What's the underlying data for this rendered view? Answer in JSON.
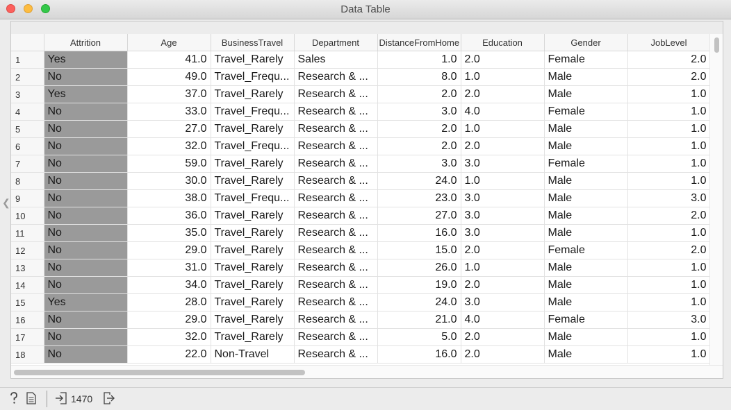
{
  "window": {
    "title": "Data Table"
  },
  "table": {
    "columns": [
      "Attrition",
      "Age",
      "BusinessTravel",
      "Department",
      "DistanceFromHome",
      "Education",
      "Gender",
      "JobLevel"
    ],
    "rows": [
      [
        "1",
        "Yes",
        "41.0",
        "Travel_Rarely",
        "Sales",
        "1.0",
        "2.0",
        "Female",
        "2.0"
      ],
      [
        "2",
        "No",
        "49.0",
        "Travel_Frequ...",
        "Research & ...",
        "8.0",
        "1.0",
        "Male",
        "2.0"
      ],
      [
        "3",
        "Yes",
        "37.0",
        "Travel_Rarely",
        "Research & ...",
        "2.0",
        "2.0",
        "Male",
        "1.0"
      ],
      [
        "4",
        "No",
        "33.0",
        "Travel_Frequ...",
        "Research & ...",
        "3.0",
        "4.0",
        "Female",
        "1.0"
      ],
      [
        "5",
        "No",
        "27.0",
        "Travel_Rarely",
        "Research & ...",
        "2.0",
        "1.0",
        "Male",
        "1.0"
      ],
      [
        "6",
        "No",
        "32.0",
        "Travel_Frequ...",
        "Research & ...",
        "2.0",
        "2.0",
        "Male",
        "1.0"
      ],
      [
        "7",
        "No",
        "59.0",
        "Travel_Rarely",
        "Research & ...",
        "3.0",
        "3.0",
        "Female",
        "1.0"
      ],
      [
        "8",
        "No",
        "30.0",
        "Travel_Rarely",
        "Research & ...",
        "24.0",
        "1.0",
        "Male",
        "1.0"
      ],
      [
        "9",
        "No",
        "38.0",
        "Travel_Frequ...",
        "Research & ...",
        "23.0",
        "3.0",
        "Male",
        "3.0"
      ],
      [
        "10",
        "No",
        "36.0",
        "Travel_Rarely",
        "Research & ...",
        "27.0",
        "3.0",
        "Male",
        "2.0"
      ],
      [
        "11",
        "No",
        "35.0",
        "Travel_Rarely",
        "Research & ...",
        "16.0",
        "3.0",
        "Male",
        "1.0"
      ],
      [
        "12",
        "No",
        "29.0",
        "Travel_Rarely",
        "Research & ...",
        "15.0",
        "2.0",
        "Female",
        "2.0"
      ],
      [
        "13",
        "No",
        "31.0",
        "Travel_Rarely",
        "Research & ...",
        "26.0",
        "1.0",
        "Male",
        "1.0"
      ],
      [
        "14",
        "No",
        "34.0",
        "Travel_Rarely",
        "Research & ...",
        "19.0",
        "2.0",
        "Male",
        "1.0"
      ],
      [
        "15",
        "Yes",
        "28.0",
        "Travel_Rarely",
        "Research & ...",
        "24.0",
        "3.0",
        "Male",
        "1.0"
      ],
      [
        "16",
        "No",
        "29.0",
        "Travel_Rarely",
        "Research & ...",
        "21.0",
        "4.0",
        "Female",
        "3.0"
      ],
      [
        "17",
        "No",
        "32.0",
        "Travel_Rarely",
        "Research & ...",
        "5.0",
        "2.0",
        "Male",
        "1.0"
      ],
      [
        "18",
        "No",
        "22.0",
        "Non-Travel",
        "Research & ...",
        "16.0",
        "2.0",
        "Male",
        "1.0"
      ]
    ]
  },
  "status": {
    "help_icon": "help-icon",
    "report_icon": "report-icon",
    "input_icon": "input-icon",
    "output_icon": "output-icon",
    "instances": "1470"
  },
  "colors": {
    "attrition_fill": "#9a9a9a"
  }
}
